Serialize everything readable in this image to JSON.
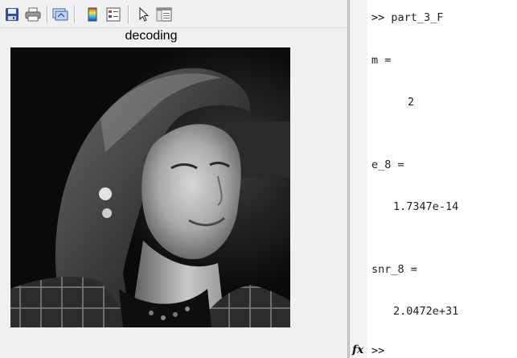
{
  "figure": {
    "axes_title": "decoding",
    "toolbar": [
      {
        "icon": "save-icon"
      },
      {
        "icon": "print-icon"
      },
      {
        "icon": "link-figure-icon"
      },
      {
        "icon": "colorbar-icon"
      },
      {
        "icon": "legend-icon"
      },
      {
        "icon": "edit-plot-icon"
      },
      {
        "icon": "plot-browser-icon"
      }
    ]
  },
  "command_window": {
    "lines": [
      {
        "prompt": ">>",
        "text": "part_3_F"
      },
      {
        "text": "m ="
      },
      {
        "text": "2"
      },
      {
        "text": "e_8 ="
      },
      {
        "text": "1.7347e-14"
      },
      {
        "text": "snr_8 ="
      },
      {
        "text": "2.0472e+31"
      }
    ],
    "fx_label": "fx",
    "final_prompt": ">>"
  }
}
